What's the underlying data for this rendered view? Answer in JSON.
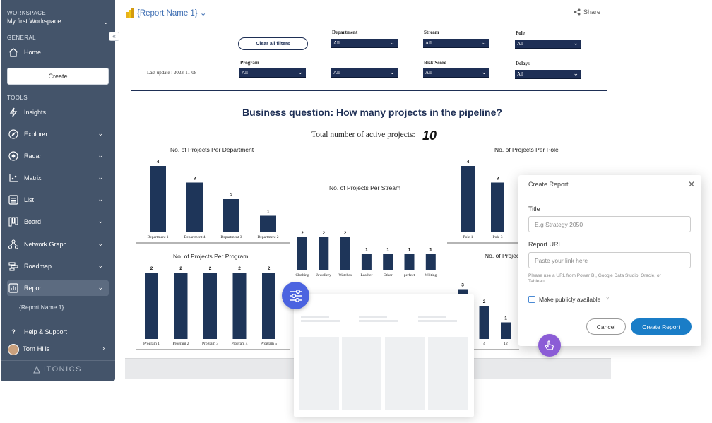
{
  "sidebar": {
    "workspace_label": "WORKSPACE",
    "workspace_name": "My first Workspace",
    "general_label": "GENERAL",
    "home": "Home",
    "create": "Create",
    "tools_label": "TOOLS",
    "items": [
      {
        "label": "Insights",
        "icon": "lightning-icon"
      },
      {
        "label": "Explorer",
        "icon": "compass-icon"
      },
      {
        "label": "Radar",
        "icon": "radar-icon"
      },
      {
        "label": "Matrix",
        "icon": "matrix-icon"
      },
      {
        "label": "List",
        "icon": "list-icon"
      },
      {
        "label": "Board",
        "icon": "board-icon"
      },
      {
        "label": "Network Graph",
        "icon": "network-icon"
      },
      {
        "label": "Roadmap",
        "icon": "roadmap-icon"
      },
      {
        "label": "Report",
        "icon": "report-icon"
      }
    ],
    "report_sub": "{Report Name 1}",
    "help": "Help & Support",
    "user": "Tom Hills",
    "logo": "ITONICS"
  },
  "header": {
    "title": "{Report Name 1}",
    "share": "Share"
  },
  "filters": {
    "clear": "Clear all filters",
    "last_update": "Last update : 2023-11-08",
    "department": "Department",
    "stream": "Stream",
    "pole": "Pole",
    "program": "Program",
    "risk_score": "Risk Score",
    "delays": "Delays",
    "all": "All"
  },
  "report": {
    "question": "Business question: How many projects in the pipeline?",
    "total_label": "Total number of active projects:",
    "total_value": "10"
  },
  "chart_data": [
    {
      "type": "bar",
      "title": "No. of Projects Per Department",
      "categories": [
        "Department 1",
        "Department 4",
        "Department 3",
        "Department 2"
      ],
      "values": [
        4,
        3,
        2,
        1
      ]
    },
    {
      "type": "bar",
      "title": "No. of Projects Per Stream",
      "categories": [
        "Clothing",
        "Jewellery",
        "Watches",
        "Leather",
        "Other",
        "perfect",
        "Writing"
      ],
      "values": [
        2,
        2,
        2,
        1,
        1,
        1,
        1
      ]
    },
    {
      "type": "bar",
      "title": "No. of Projects Per Program",
      "categories": [
        "Program 1",
        "Program 2",
        "Program 3",
        "Program 4",
        "Program 5"
      ],
      "values": [
        2,
        2,
        2,
        2,
        2
      ]
    },
    {
      "type": "bar",
      "title": "No. of Projects Per Pole",
      "categories": [
        "Pole 1",
        "Pole 3"
      ],
      "values": [
        4,
        3
      ]
    },
    {
      "type": "bar",
      "title": "No. of Projec",
      "categories": [
        "",
        "4",
        "12"
      ],
      "values": [
        3,
        2,
        1
      ]
    }
  ],
  "dialog": {
    "title": "Create Report",
    "title_label": "Title",
    "title_placeholder": "E.g Strategy 2050",
    "url_label": "Report URL",
    "url_placeholder": "Paste your link here",
    "help": "Please use a URL from Power BI, Google Data Studio, Oracle, or Tableau.",
    "public_label": "Make publicly available",
    "qmark": "?",
    "cancel": "Cancel",
    "create": "Create Report"
  },
  "colors": {
    "sidebar": "#44546a",
    "bar": "#1e3559",
    "primary": "#1a7dc7",
    "fab": "#4b63e0",
    "hand": "#8b5cd6"
  }
}
